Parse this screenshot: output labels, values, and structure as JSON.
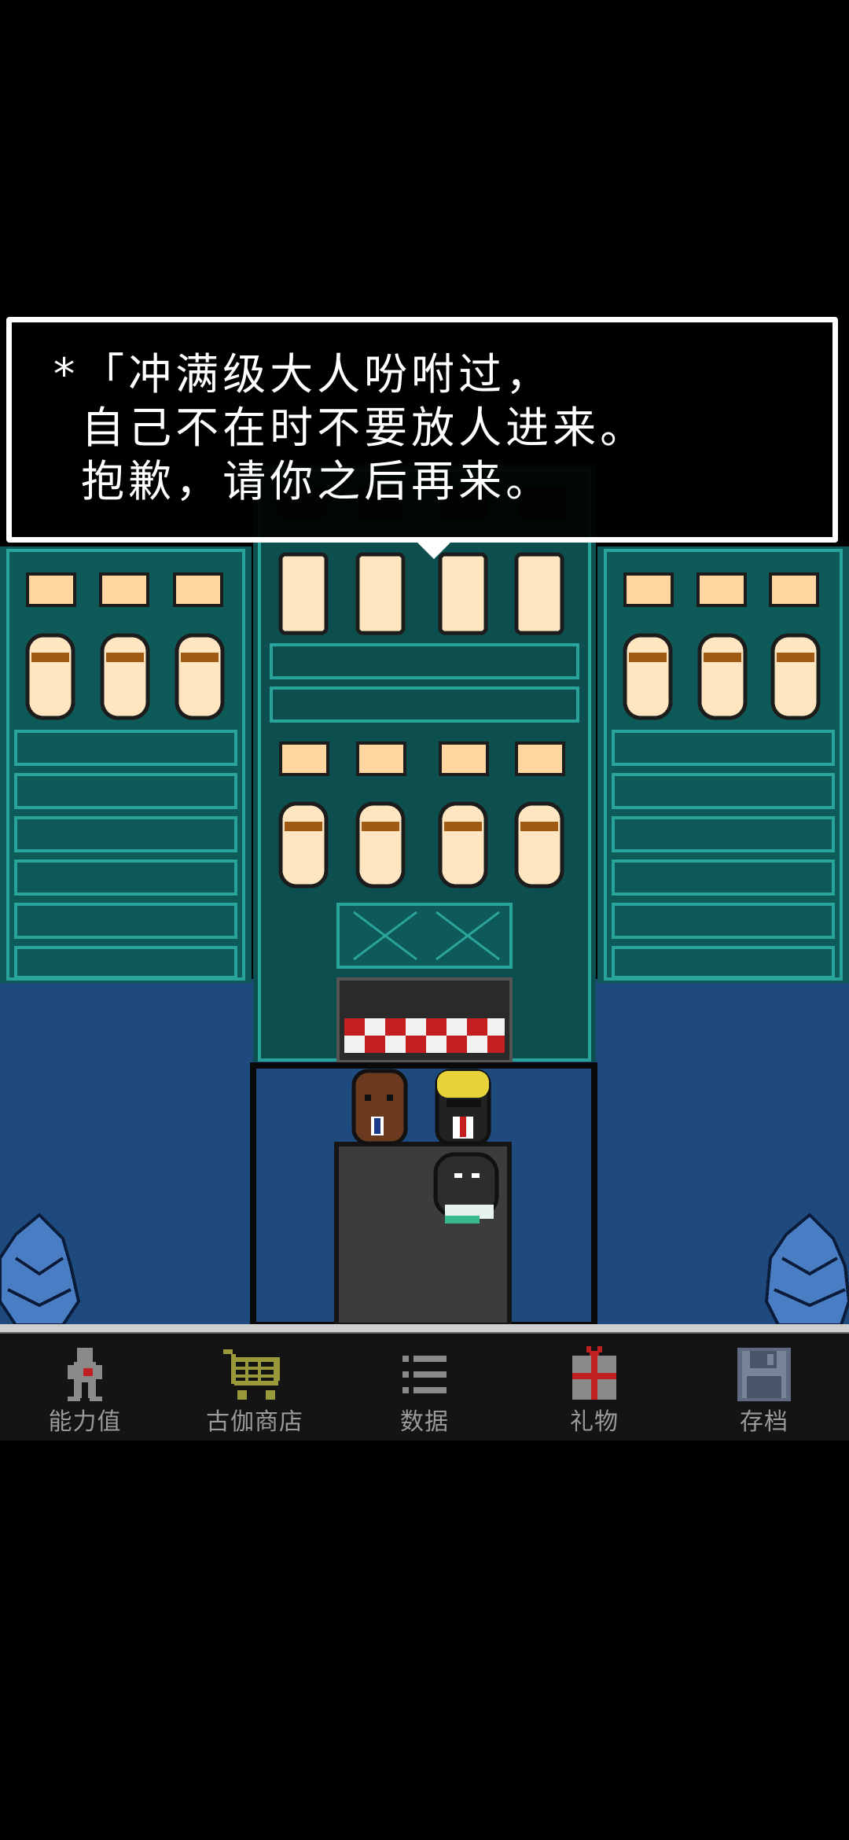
{
  "dialogue": {
    "lines": [
      "*「冲满级大人吩咐过，",
      " 自己不在时不要放人进来。",
      " 抱歉，请你之后再来。"
    ]
  },
  "bottom_nav": {
    "items": [
      {
        "label": "能力值",
        "icon": "person-stats-icon"
      },
      {
        "label": "古伽商店",
        "icon": "shopping-cart-icon"
      },
      {
        "label": "数据",
        "icon": "list-icon"
      },
      {
        "label": "礼物",
        "icon": "gift-icon"
      },
      {
        "label": "存档",
        "icon": "floppy-disk-icon"
      }
    ]
  },
  "colors": {
    "background": "#000000",
    "building_teal": "#0e5a58",
    "building_trim": "#2aa39a",
    "window_glow": "#ffd6a0",
    "ground_blue": "#1f4a7e",
    "path_gray": "#3c3c3c",
    "nav_bar": "#141414",
    "nav_label": "#9a9a9a",
    "cart_olive": "#9a9a3a",
    "gift_red": "#c02020"
  }
}
